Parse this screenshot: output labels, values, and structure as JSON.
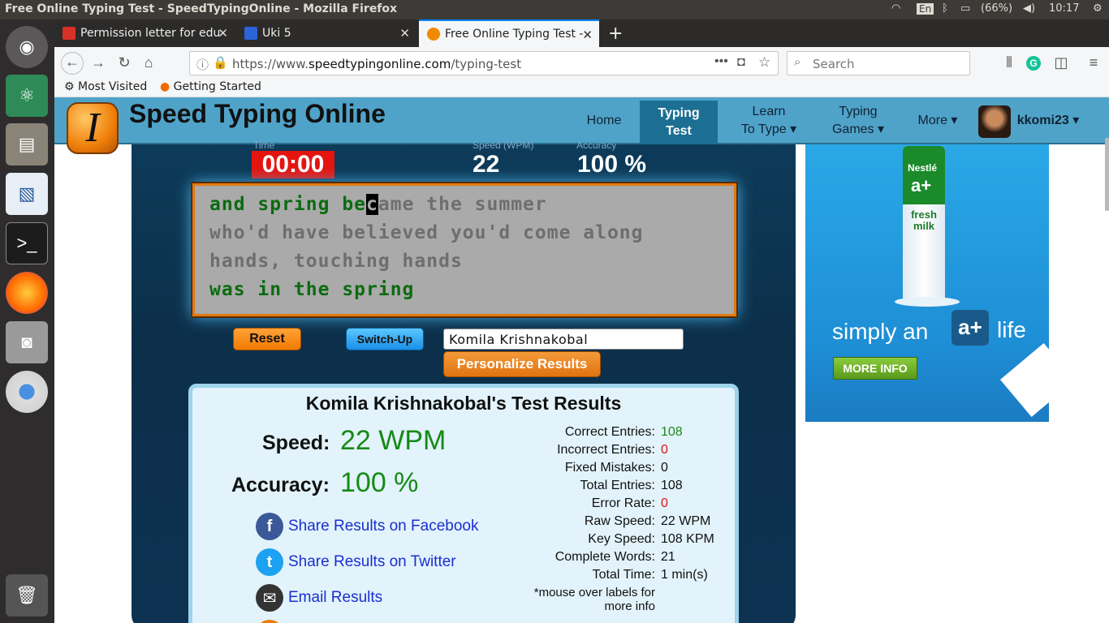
{
  "window": {
    "title": "Free Online Typing Test - SpeedTypingOnline - Mozilla Firefox"
  },
  "tray": {
    "lang": "En",
    "battery": "(66%)",
    "time": "10:17"
  },
  "tabs": [
    {
      "label": "Permission letter for edu",
      "color": "#d93025"
    },
    {
      "label": "Uki 5",
      "color": "#2a64d8"
    },
    {
      "label": "Free Online Typing Test -",
      "color": "#f08a00"
    }
  ],
  "nav": {
    "url_prefix": "https://www.",
    "url_domain": "speedtypingonline.com",
    "url_path": "/typing-test",
    "search_placeholder": "Search"
  },
  "bookmarks": {
    "most_visited": "Most Visited",
    "getting_started": "Getting Started"
  },
  "site": {
    "name": "Speed Typing Online",
    "logo_letter": "I",
    "menu": {
      "home": "Home",
      "typing_test_1": "Typing",
      "typing_test_2": "Test",
      "learn_1": "Learn",
      "learn_2": "To Type",
      "games_1": "Typing",
      "games_2": "Games",
      "more": "More",
      "user": "kkomi23"
    }
  },
  "test": {
    "time_label": "Time",
    "speed_label": "Speed (WPM)",
    "accuracy_label": "Accuracy",
    "timer": "00:00",
    "speed": "22",
    "accuracy": "100 %",
    "line1_typed": "and spring be",
    "line1_cursor": "c",
    "line1_rest": "ame the summer",
    "line2": "who'd have believed you'd come along",
    "line3": "hands, touching hands",
    "line4": "was in the spring",
    "reset": "Reset",
    "switch_up": "Switch-Up",
    "name_value": "Komila Krishnakobal",
    "personalize": "Personalize Results"
  },
  "results": {
    "title": "Komila Krishnakobal's Test Results",
    "speed_label": "Speed:",
    "speed_value": "22 WPM",
    "accuracy_label": "Accuracy:",
    "accuracy_value": "100 %",
    "share_facebook": "Share Results on Facebook",
    "share_twitter": "Share Results on Twitter",
    "email": "Email Results",
    "stats": [
      {
        "label": "Correct Entries:",
        "value": "108",
        "color": "#1a8a1a"
      },
      {
        "label": "Incorrect Entries:",
        "value": "0",
        "color": "#e01010"
      },
      {
        "label": "Fixed Mistakes:",
        "value": "0",
        "color": "#111"
      },
      {
        "label": "Total Entries:",
        "value": "108",
        "color": "#111"
      },
      {
        "label": "Error Rate:",
        "value": "0",
        "color": "#e01010"
      },
      {
        "label": "Raw Speed:",
        "value": "22 WPM",
        "color": "#111"
      },
      {
        "label": "Key Speed:",
        "value": "108 KPM",
        "color": "#111"
      },
      {
        "label": "Complete Words:",
        "value": "21",
        "color": "#111"
      },
      {
        "label": "Total Time:",
        "value": "1 min(s)",
        "color": "#111"
      }
    ],
    "note_1": "*mouse over labels for",
    "note_2": "more info"
  },
  "ad": {
    "brand": "Nestlé",
    "product": "a+",
    "milk": "fresh milk",
    "tagline_1": "simply an",
    "tagline_2": "life",
    "cta": "MORE INFO"
  }
}
